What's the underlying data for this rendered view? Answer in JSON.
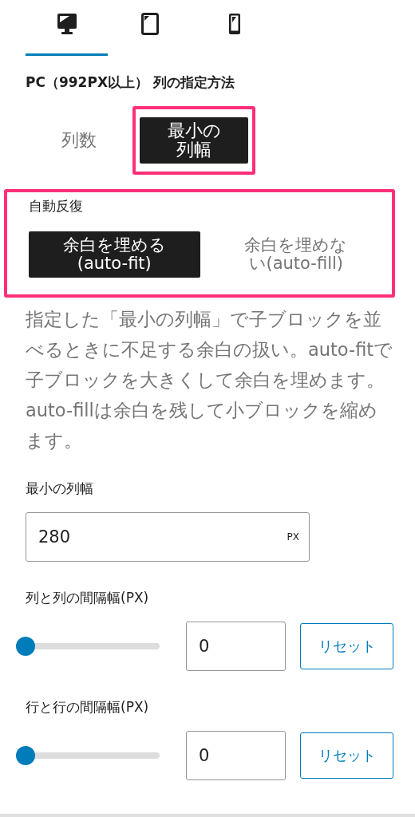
{
  "device_tabs": [
    {
      "kind": "desktop",
      "selected": true
    },
    {
      "kind": "tablet",
      "selected": false
    },
    {
      "kind": "phone",
      "selected": false
    }
  ],
  "heading": "PC（992PX以上） 列の指定方法",
  "method_options": [
    {
      "label": "列数",
      "selected": false
    },
    {
      "label": "最小の列幅",
      "selected": true
    }
  ],
  "auto_repeat": {
    "label": "自動反復",
    "options": [
      {
        "label": "余白を埋める(auto-fit)",
        "selected": true
      },
      {
        "label": "余白を埋めない(auto-fill)",
        "selected": false
      }
    ]
  },
  "description": "指定した「最小の列幅」で子ブロックを並べるときに不足する余白の扱い。auto-fitで子ブロックを大きくして余白を埋めます。auto-fillは余白を残して小ブロックを縮めます。",
  "min_width": {
    "label": "最小の列幅",
    "value": "280",
    "unit": "PX"
  },
  "gaps": [
    {
      "label": "列と列の間隔幅(PX)",
      "level": 0,
      "value": "0",
      "reset": "リセット"
    },
    {
      "label": "行と行の間隔幅(PX)",
      "level": 0,
      "value": "0",
      "reset": "リセット"
    }
  ]
}
